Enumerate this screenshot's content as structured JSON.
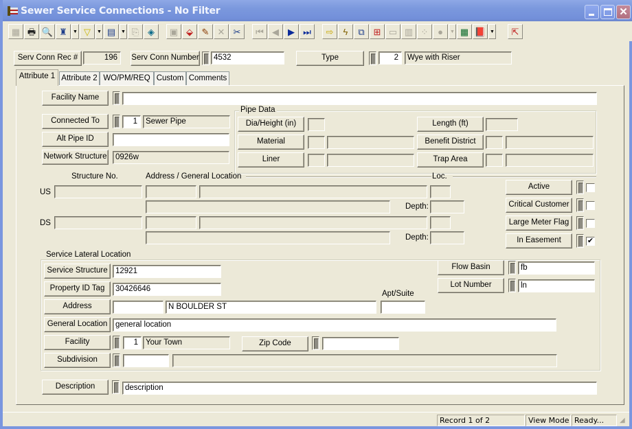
{
  "window": {
    "title": "Sewer Service Connections - No Filter",
    "controls": [
      "minimize",
      "maximize",
      "close"
    ]
  },
  "toolbar": {
    "buttons": [
      {
        "name": "screen-icon",
        "glyph": "▦",
        "enabled": false
      },
      {
        "name": "print-icon",
        "glyph": "🖶",
        "enabled": true
      },
      {
        "name": "zoom-find-icon",
        "glyph": "🔍",
        "enabled": true
      },
      {
        "name": "binoculars-search-icon",
        "glyph": "♜",
        "enabled": true,
        "dropdown": true
      },
      {
        "name": "filter-icon",
        "glyph": "▽",
        "enabled": true,
        "dropdown": true
      },
      {
        "name": "report-icon",
        "glyph": "▤",
        "enabled": true,
        "dropdown": true
      },
      {
        "name": "export-icon",
        "glyph": "⎘",
        "enabled": false
      },
      {
        "name": "globe-document-icon",
        "glyph": "◈",
        "enabled": true
      },
      {
        "name": "save-icon",
        "glyph": "▣",
        "enabled": false
      },
      {
        "name": "add-record-icon",
        "glyph": "⬙",
        "enabled": true
      },
      {
        "name": "edit-pencil-icon",
        "glyph": "✎",
        "enabled": true
      },
      {
        "name": "delete-icon",
        "glyph": "✕",
        "enabled": false
      },
      {
        "name": "cut-icon",
        "glyph": "✂",
        "enabled": true
      },
      {
        "name": "first-record-icon",
        "glyph": "⏮",
        "enabled": false
      },
      {
        "name": "previous-record-icon",
        "glyph": "◀",
        "enabled": false
      },
      {
        "name": "next-record-icon",
        "glyph": "▶",
        "enabled": true
      },
      {
        "name": "last-record-icon",
        "glyph": "⏭",
        "enabled": true
      },
      {
        "name": "goto-arrow-icon",
        "glyph": "⇨",
        "enabled": true
      },
      {
        "name": "lightning-icon",
        "glyph": "ϟ",
        "enabled": true
      },
      {
        "name": "relationships-icon",
        "glyph": "⧉",
        "enabled": true
      },
      {
        "name": "network-icon",
        "glyph": "⊞",
        "enabled": true
      },
      {
        "name": "command-icon",
        "glyph": "▭",
        "enabled": false
      },
      {
        "name": "grid-icon",
        "glyph": "▥",
        "enabled": false
      },
      {
        "name": "scatter-icon",
        "glyph": "⁘",
        "enabled": false
      },
      {
        "name": "help-bubble-icon",
        "glyph": "●",
        "enabled": false,
        "dropdown": true
      },
      {
        "name": "calculator-icon",
        "glyph": "▦",
        "enabled": true
      },
      {
        "name": "help-book-icon",
        "glyph": "📕",
        "enabled": true,
        "dropdown": true
      },
      {
        "name": "exit-icon",
        "glyph": "⇱",
        "enabled": true
      }
    ]
  },
  "header": {
    "rec_label": "Serv Conn Rec #",
    "rec_value": "196",
    "number_label": "Serv Conn Number",
    "number_value": "4532",
    "type_label": "Type",
    "type_code": "2",
    "type_desc": "Wye with Riser"
  },
  "tabs": [
    {
      "label": "Attribute 1",
      "active": true
    },
    {
      "label": "Attribute 2",
      "active": false
    },
    {
      "label": "WO/PM/REQ",
      "active": false
    },
    {
      "label": "Custom",
      "active": false
    },
    {
      "label": "Comments",
      "active": false
    }
  ],
  "attribute1": {
    "facility_name": {
      "label": "Facility Name",
      "value": ""
    },
    "connected_to": {
      "label": "Connected To",
      "code": "1",
      "desc": "Sewer Pipe"
    },
    "alt_pipe_id": {
      "label": "Alt Pipe ID",
      "value": ""
    },
    "network_structure": {
      "label": "Network Structure",
      "value": "0926w"
    },
    "pipe_data": {
      "title": "Pipe Data",
      "dia_height": {
        "label": "Dia/Height (in)",
        "value": ""
      },
      "material": {
        "label": "Material",
        "code": "",
        "desc": ""
      },
      "liner": {
        "label": "Liner",
        "code": "",
        "desc": ""
      },
      "length": {
        "label": "Length (ft)",
        "value": ""
      },
      "benefit_district": {
        "label": "Benefit District",
        "code": "",
        "desc": ""
      },
      "trap_area": {
        "label": "Trap Area",
        "code": "",
        "desc": ""
      }
    },
    "structures": {
      "structure_no_header": "Structure No.",
      "address_header": "Address / General Location",
      "loc_header": "Loc.",
      "depth_label": "Depth:",
      "us_label": "US",
      "ds_label": "DS"
    },
    "flags": [
      {
        "label": "Active",
        "checked": false
      },
      {
        "label": "Critical Customer",
        "checked": false
      },
      {
        "label": "Large Meter Flag",
        "checked": false
      },
      {
        "label": "In Easement",
        "checked": true
      }
    ],
    "service_lateral": {
      "title": "Service Lateral Location",
      "service_structure": {
        "label": "Service Structure",
        "value": "12921"
      },
      "property_id_tag": {
        "label": "Property ID Tag",
        "value": "30426646"
      },
      "address": {
        "label": "Address",
        "number": "",
        "street": "N BOULDER ST",
        "apt_label": "Apt/Suite",
        "apt": ""
      },
      "general_location": {
        "label": "General Location",
        "value": "general location"
      },
      "facility": {
        "label": "Facility",
        "code": "1",
        "desc": "Your Town"
      },
      "zip_code": {
        "label": "Zip Code",
        "value": ""
      },
      "subdivision": {
        "label": "Subdivision",
        "code": "",
        "desc": ""
      },
      "flow_basin": {
        "label": "Flow Basin",
        "value": "fb"
      },
      "lot_number": {
        "label": "Lot Number",
        "value": "ln"
      }
    },
    "description": {
      "label": "Description",
      "value": "description"
    }
  },
  "status_bar": {
    "record": "Record 1 of 2",
    "mode": "View Mode",
    "state": "Ready..."
  }
}
